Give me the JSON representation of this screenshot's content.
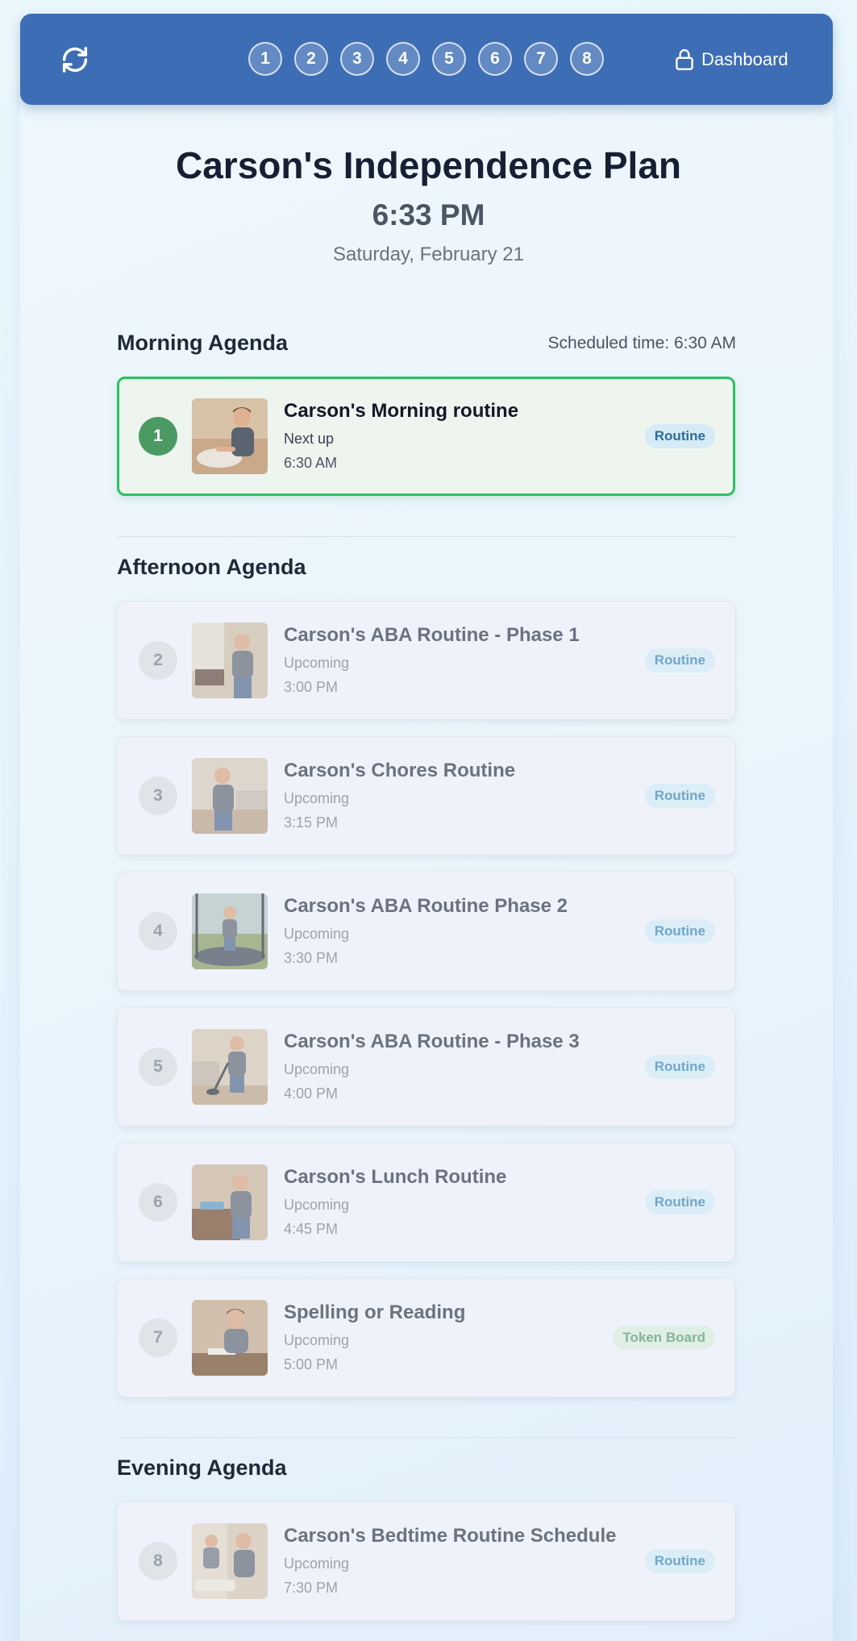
{
  "header": {
    "steps": [
      "1",
      "2",
      "3",
      "4",
      "5",
      "6",
      "7",
      "8"
    ],
    "dashboard_label": "Dashboard",
    "refresh_icon": "refresh-icon",
    "lock_icon": "lock-icon"
  },
  "plan": {
    "title": "Carson's Independence Plan",
    "time": "6:33 PM",
    "date": "Saturday, February 21"
  },
  "morning": {
    "title": "Morning Agenda",
    "scheduled": "Scheduled time: 6:30 AM",
    "items": [
      {
        "num": "1",
        "name": "Carson's Morning routine",
        "status": "Next up",
        "time": "6:30 AM",
        "badge": "Routine"
      }
    ]
  },
  "afternoon": {
    "title": "Afternoon Agenda",
    "items": [
      {
        "num": "2",
        "name": "Carson's ABA Routine - Phase 1",
        "status": "Upcoming",
        "time": "3:00 PM",
        "badge": "Routine"
      },
      {
        "num": "3",
        "name": "Carson's Chores Routine",
        "status": "Upcoming",
        "time": "3:15 PM",
        "badge": "Routine"
      },
      {
        "num": "4",
        "name": "Carson's ABA Routine Phase 2",
        "status": "Upcoming",
        "time": "3:30 PM",
        "badge": "Routine"
      },
      {
        "num": "5",
        "name": "Carson's ABA Routine - Phase 3",
        "status": "Upcoming",
        "time": "4:00 PM",
        "badge": "Routine"
      },
      {
        "num": "6",
        "name": "Carson's Lunch Routine",
        "status": "Upcoming",
        "time": "4:45 PM",
        "badge": "Routine"
      },
      {
        "num": "7",
        "name": "Spelling or Reading",
        "status": "Upcoming",
        "time": "5:00 PM",
        "badge": "Token Board"
      }
    ]
  },
  "evening": {
    "title": "Evening Agenda",
    "items": [
      {
        "num": "8",
        "name": "Carson's Bedtime Routine Schedule",
        "status": "Upcoming",
        "time": "7:30 PM",
        "badge": "Routine"
      }
    ]
  },
  "colors": {
    "header_bg": "#3d6db4",
    "active_border": "#2cc063",
    "active_number": "#4b9a63"
  }
}
